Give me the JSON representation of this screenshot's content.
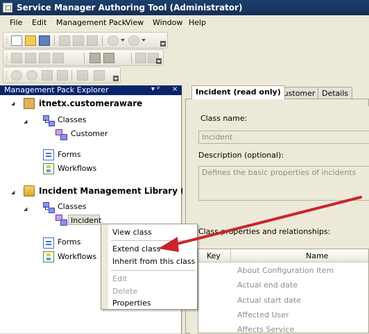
{
  "window": {
    "title": "Service Manager Authoring Tool (Administrator)"
  },
  "menu": {
    "items": [
      "File",
      "Edit",
      "Management Pack",
      "View",
      "Window",
      "Help"
    ]
  },
  "explorer": {
    "title": "Management Pack Explorer",
    "pin_glyph": "▾ ᵖ",
    "close_glyph": "×",
    "tree": {
      "mp1": {
        "name": "itnetx.customeraware",
        "classes": "Classes",
        "class_item": "Customer",
        "forms": "Forms",
        "workflows": "Workflows"
      },
      "mp2": {
        "name": "Incident Management Library (sea",
        "classes": "Classes",
        "class_item": "Incident",
        "forms": "Forms",
        "workflows": "Workflows"
      }
    }
  },
  "context_menu": {
    "view_class": "View class",
    "extend_class": "Extend class",
    "inherit_class": "Inherit from this class",
    "edit": "Edit",
    "delete": "Delete",
    "properties": "Properties"
  },
  "tabs": [
    "Incident (read only)",
    "Customer",
    "Details"
  ],
  "form": {
    "class_name_label": "Class name:",
    "class_name_value": "Incident",
    "description_label": "Description (optional):",
    "description_value": "Defines the basic properties of incidents",
    "relationships_label": "Class properties and relationships:"
  },
  "grid": {
    "headers": [
      "Key",
      "Name"
    ],
    "rows": [
      "About Configuration Item",
      "Actual end date",
      "Actual start date",
      "Affected User",
      "Affects Service"
    ]
  },
  "colors": {
    "title_bar": "#142f55",
    "explorer_header": "#0a246a",
    "annotation_arrow": "#c8262a"
  }
}
